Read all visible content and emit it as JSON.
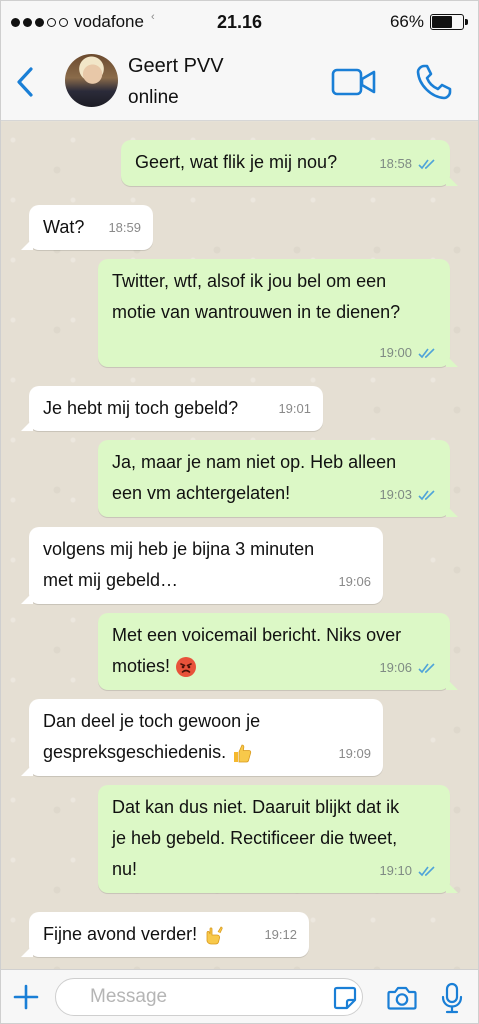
{
  "status_bar": {
    "carrier": "vodafone",
    "signal_dots_filled": 3,
    "signal_dots_total": 5,
    "time": "21.16",
    "battery_text": "66%",
    "battery_level": 0.66
  },
  "header": {
    "contact_name": "Geert PVV",
    "contact_status": "online",
    "back_icon": "chevron-left-icon",
    "video_icon": "video-camera-icon",
    "call_icon": "phone-icon"
  },
  "messages": [
    {
      "direction": "out",
      "lines": [
        "Geert, wat flik je mij nou?"
      ],
      "time": "18:58",
      "read": true
    },
    {
      "direction": "in",
      "lines": [
        "Wat?"
      ],
      "time": "18:59"
    },
    {
      "direction": "out",
      "lines": [
        "Twitter, wtf, alsof ik jou bel om een",
        "motie van wantrouwen in te dienen?"
      ],
      "time": "19:00",
      "read": true
    },
    {
      "direction": "in",
      "lines": [
        "Je hebt mij toch gebeld?"
      ],
      "time": "19:01"
    },
    {
      "direction": "out",
      "lines": [
        "Ja, maar je nam niet op. Heb alleen",
        "een vm achtergelaten!"
      ],
      "time": "19:03",
      "read": true
    },
    {
      "direction": "in",
      "lines": [
        "volgens mij heb je bijna 3 minuten",
        "met mij gebeld…"
      ],
      "time": "19:06"
    },
    {
      "direction": "out",
      "lines": [
        "Met een voicemail bericht. Niks over",
        "moties!"
      ],
      "time": "19:06",
      "read": true,
      "emoji": "angry-face-icon"
    },
    {
      "direction": "in",
      "lines": [
        "Dan deel je toch gewoon je",
        "gespreksgeschiedenis."
      ],
      "time": "19:09",
      "emoji": "thumbs-up-icon"
    },
    {
      "direction": "out",
      "lines": [
        "Dat kan dus niet. Daaruit blijkt dat ik",
        "je heb gebeld. Rectificeer die tweet,",
        "nu!"
      ],
      "time": "19:10",
      "read": true
    },
    {
      "direction": "in",
      "lines": [
        "Fijne avond verder!"
      ],
      "time": "19:12",
      "emoji": "call-me-hand-icon"
    }
  ],
  "input_bar": {
    "placeholder": "Message",
    "value": "",
    "icons": [
      "plus-icon",
      "sticker-icon",
      "camera-icon",
      "microphone-icon"
    ]
  },
  "colors": {
    "accent": "#1a7fd6",
    "outgoing_bubble": "#dcf8c6",
    "incoming_bubble": "#ffffff",
    "read_ticks": "#4fa3d9",
    "chat_background": "#e5dfd3"
  }
}
